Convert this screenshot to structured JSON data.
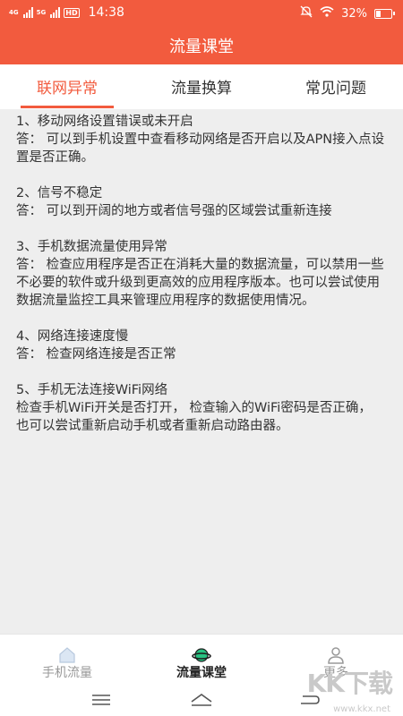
{
  "status_bar": {
    "network_1": "4G",
    "network_2": "5G",
    "hd": "HD",
    "time": "14:38",
    "battery_text": "32%",
    "battery_level": 0.32
  },
  "header": {
    "title": "流量课堂"
  },
  "tabs": [
    {
      "label": "联网异常",
      "active": true
    },
    {
      "label": "流量换算",
      "active": false
    },
    {
      "label": "常见问题",
      "active": false
    }
  ],
  "faq": [
    {
      "q": "1、移动网络设置错误或未开启",
      "a": "答：  可以到手机设置中查看移动网络是否开启以及APN接入点设置是否正确。"
    },
    {
      "q": "2、信号不稳定",
      "a": "答：  可以到开阔的地方或者信号强的区域尝试重新连接"
    },
    {
      "q": "3、手机数据流量使用异常",
      "a": "答：  检查应用程序是否正在消耗大量的数据流量，可以禁用一些不必要的软件或升级到更高效的应用程序版本。也可以尝试使用数据流量监控工具来管理应用程序的数据使用情况。"
    },
    {
      "q": "4、网络连接速度慢",
      "a": "答：  检查网络连接是否正常"
    },
    {
      "q": "5、手机无法连接WiFi网络",
      "a": "检查手机WiFi开关是否打开，  检查输入的WiFi密码是否正确，  也可以尝试重新启动手机或者重新启动路由器。"
    }
  ],
  "bottom_nav": [
    {
      "label": "手机流量",
      "icon": "home-icon",
      "active": false
    },
    {
      "label": "流量课堂",
      "icon": "planet-icon",
      "active": true
    },
    {
      "label": "更多",
      "icon": "person-icon",
      "active": false
    }
  ],
  "watermark": {
    "text": "KK下载",
    "url": "www.kkx.net"
  },
  "colors": {
    "accent": "#f25b3e",
    "background": "#eeeeee"
  }
}
